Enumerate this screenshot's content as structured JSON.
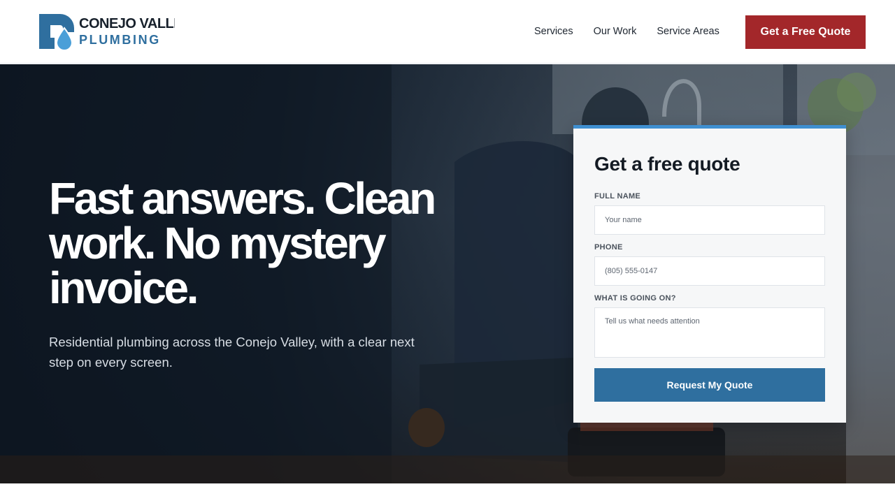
{
  "brand": {
    "name_line1": "CONEJO VALLEY",
    "name_line2": "PLUMBING",
    "logo_icon": "droplet-icon",
    "colors": {
      "dark": "#17202b",
      "blue": "#2f6f9f",
      "light_blue": "#4a9fd8"
    }
  },
  "nav": {
    "items": [
      {
        "label": "Services"
      },
      {
        "label": "Our Work"
      },
      {
        "label": "Service Areas"
      }
    ],
    "cta_label": "Get a Free Quote",
    "cta_color": "#a3272a"
  },
  "hero": {
    "headline": "Fast answers. Clean work. No mystery invoice.",
    "subtext": "Residential plumbing across the Conejo Valley, with a clear next step on every screen."
  },
  "quote_form": {
    "title": "Get a free quote",
    "accent_color": "#3f8fd0",
    "fields": [
      {
        "label": "FULL NAME",
        "placeholder": "Your name"
      },
      {
        "label": "PHONE",
        "placeholder": "(805) 555-0147"
      },
      {
        "label": "WHAT IS GOING ON?",
        "placeholder": "Tell us what needs attention"
      }
    ],
    "submit_label": "Request My Quote",
    "submit_color": "#2f6f9f"
  }
}
